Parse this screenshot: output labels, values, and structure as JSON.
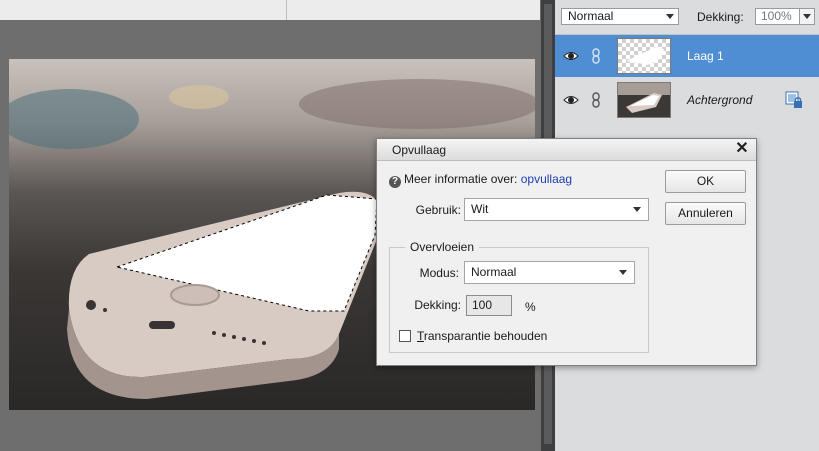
{
  "layers_panel": {
    "blend_mode": "Normaal",
    "opacity_label": "Dekking:",
    "opacity_value": "100%",
    "layers": [
      {
        "name": "Laag 1",
        "selected": true,
        "visible": true
      },
      {
        "name": "Achtergrond",
        "selected": false,
        "visible": true,
        "locked": true
      }
    ]
  },
  "dialog": {
    "title": "Opvullaag",
    "help_prefix": "Meer informatie over:",
    "help_link": "opvullaag",
    "ok_label": "OK",
    "cancel_label": "Annuleren",
    "use_label": "Gebruik:",
    "use_value": "Wit",
    "group_label": "Overvloeien",
    "mode_label": "Modus:",
    "mode_value": "Normaal",
    "opacity_label": "Dekking:",
    "opacity_value": "100",
    "opacity_unit": "%",
    "preserve_transparency_label_first": "T",
    "preserve_transparency_label_rest": "ransparantie behouden",
    "preserve_transparency_checked": false
  },
  "colors": {
    "selected_layer": "#4f8ed2",
    "panel_bg": "#dbdcde",
    "link": "#1e3fb0"
  }
}
